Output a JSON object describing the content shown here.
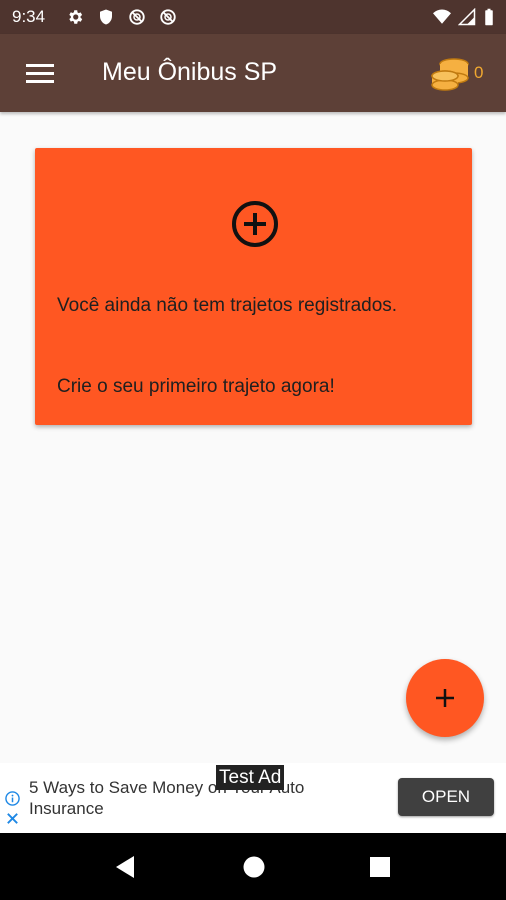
{
  "status_bar": {
    "time": "9:34",
    "icons": [
      "gear-icon",
      "shield-icon",
      "blocked-icon",
      "blocked-icon",
      "wifi-icon",
      "signal-icon",
      "battery-icon"
    ]
  },
  "app_bar": {
    "title": "Meu Ônibus SP",
    "coin_count": "0",
    "background": "#5d4037",
    "icons": [
      "menu-icon",
      "coins-icon"
    ]
  },
  "empty_card": {
    "message": "Você ainda não tem trajetos registrados.",
    "cta": "Crie o seu primeiro trajeto agora!",
    "color": "#ff5722",
    "icon": "add-circle-icon"
  },
  "fab": {
    "icon": "plus-icon",
    "color": "#ff5722"
  },
  "ad": {
    "label": "Test Ad",
    "text": "5 Ways to Save Money on Your Auto Insurance",
    "button": "OPEN"
  },
  "nav_bar": {
    "icons": [
      "back-icon",
      "home-icon",
      "recents-icon"
    ]
  }
}
